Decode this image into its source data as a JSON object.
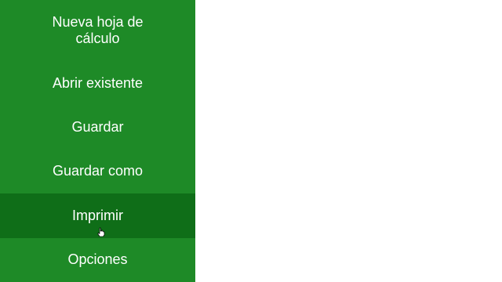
{
  "menu": {
    "items": [
      {
        "label": "Nueva hoja de cálculo",
        "active": false
      },
      {
        "label": "Abrir existente",
        "active": false
      },
      {
        "label": "Guardar",
        "active": false
      },
      {
        "label": "Guardar como",
        "active": false
      },
      {
        "label": "Imprimir",
        "active": true
      },
      {
        "label": "Opciones",
        "active": false
      }
    ]
  },
  "colors": {
    "sidebar": "#1e8a27",
    "active_item": "#0f6e18",
    "text": "#ffffff",
    "content": "#ffffff"
  },
  "icons": {
    "pointer": "hand-pointer-icon"
  }
}
